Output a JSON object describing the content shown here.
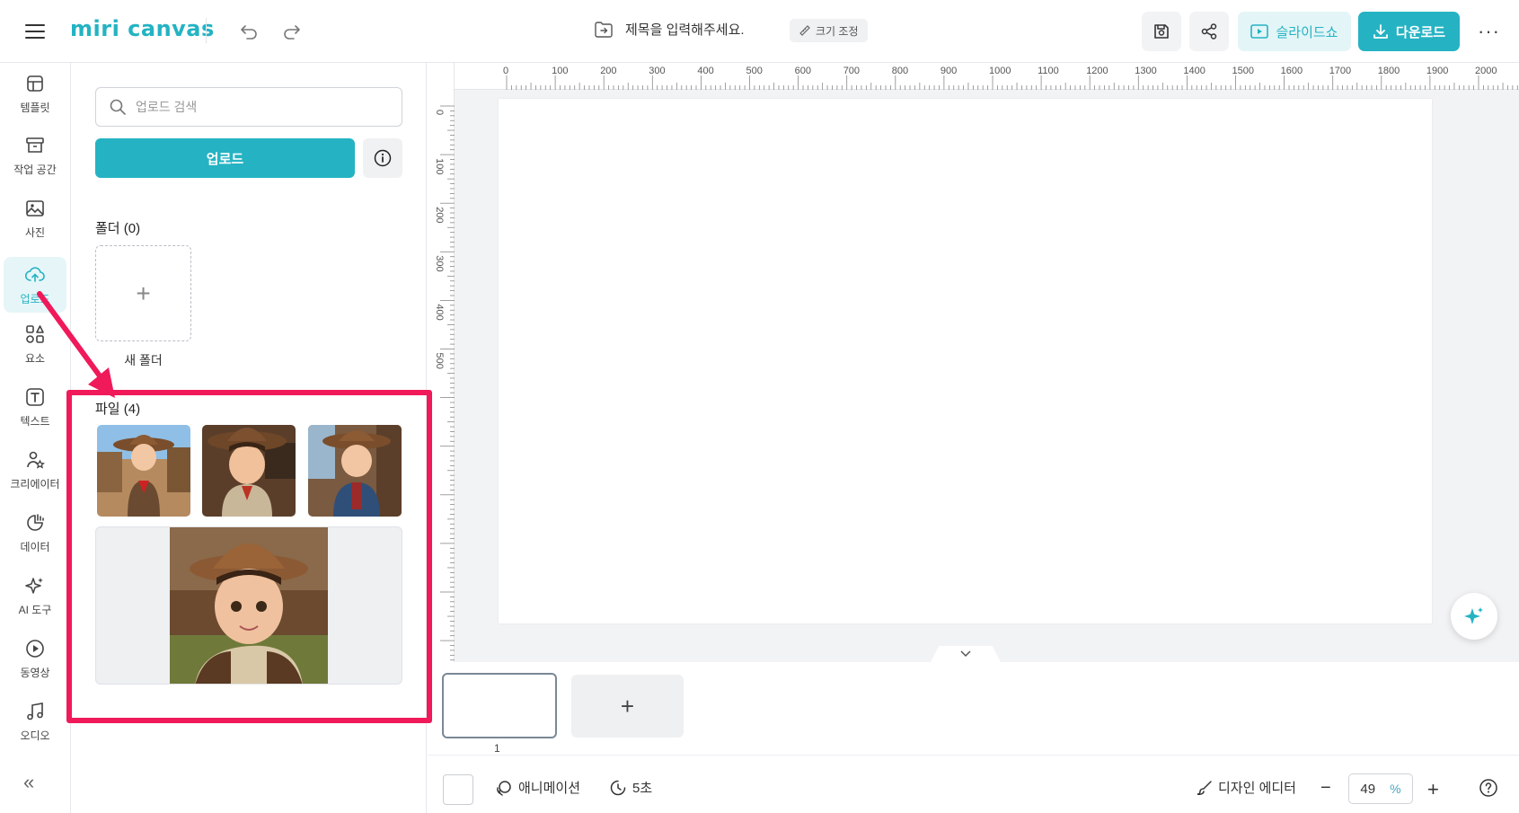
{
  "app": {
    "logo": "miri canvas"
  },
  "header": {
    "title_placeholder": "제목을 입력해주세요.",
    "resize_label": "크기 조정",
    "slideshow_label": "슬라이드쇼",
    "download_label": "다운로드",
    "more_label": "···"
  },
  "sidenav": {
    "items": [
      {
        "label": "템플릿",
        "icon": "template-icon"
      },
      {
        "label": "작업 공간",
        "icon": "archive-icon"
      },
      {
        "label": "사진",
        "icon": "image-icon"
      },
      {
        "label": "업로드",
        "icon": "cloud-upload-icon",
        "active": true
      },
      {
        "label": "요소",
        "icon": "shapes-icon"
      },
      {
        "label": "텍스트",
        "icon": "text-icon"
      },
      {
        "label": "크리에이터",
        "icon": "creator-icon"
      },
      {
        "label": "데이터",
        "icon": "chart-icon"
      },
      {
        "label": "AI 도구",
        "icon": "sparkle-icon"
      },
      {
        "label": "동영상",
        "icon": "play-icon"
      },
      {
        "label": "오디오",
        "icon": "music-icon"
      }
    ],
    "collapse_label": "«"
  },
  "panel": {
    "search_placeholder": "업로드 검색",
    "upload_label": "업로드",
    "folders_label": "폴더 (0)",
    "new_folder_plus": "+",
    "new_folder_label": "새 폴더",
    "files_label": "파일 (4)"
  },
  "ruler": {
    "top_ticks": [
      "0",
      "100",
      "200",
      "300",
      "400",
      "500",
      "600",
      "700",
      "800",
      "900",
      "1000",
      "1100",
      "1200",
      "1300",
      "1400",
      "1500",
      "1600",
      "1700",
      "1800",
      "1900",
      "2000"
    ],
    "left_ticks": [
      "0",
      "100",
      "200",
      "300",
      "400",
      "500"
    ]
  },
  "pages": {
    "current_number": "1",
    "add_label": "+"
  },
  "bottombar": {
    "animation_label": "애니메이션",
    "duration_label": "5초",
    "design_editor_label": "디자인 에디터",
    "zoom_minus": "−",
    "zoom_value": "49",
    "zoom_unit": "%",
    "zoom_plus": "+",
    "help_label": "?"
  },
  "colors": {
    "accent": "#25b3c3",
    "highlight": "#f0195a"
  }
}
